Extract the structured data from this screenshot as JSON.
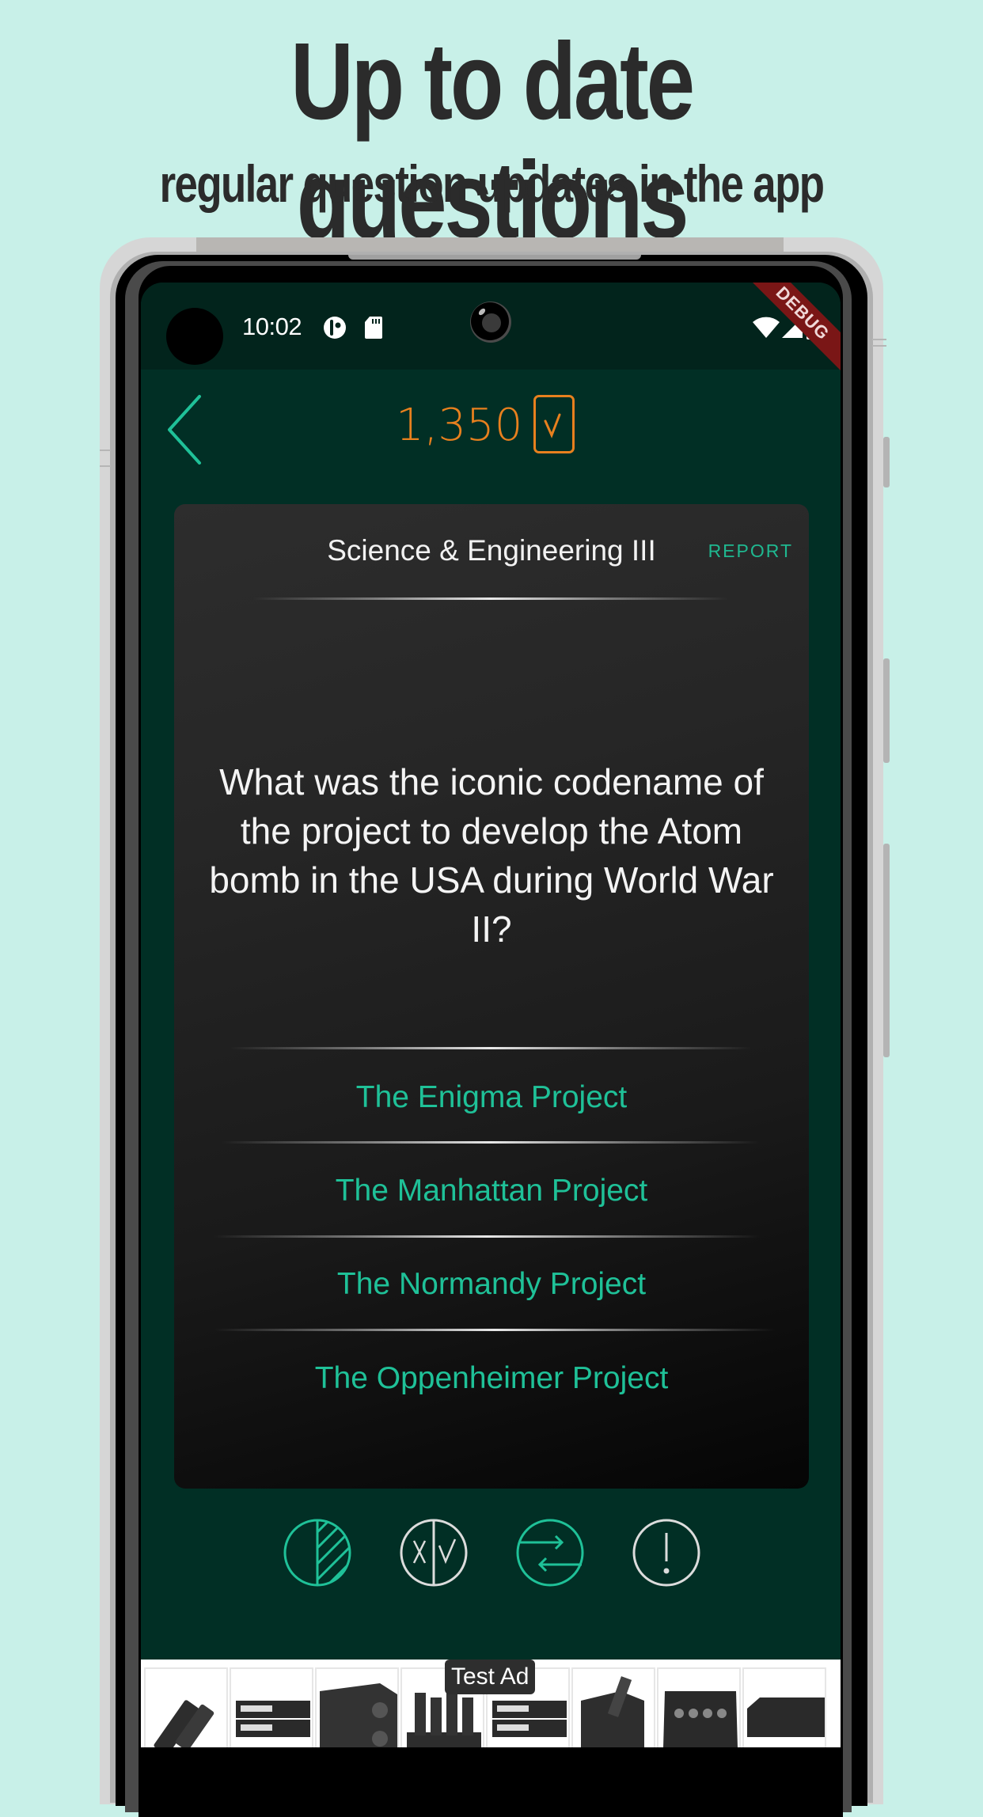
{
  "promo": {
    "headline": "Up to date questions",
    "subheadline": "regular question updates in the app"
  },
  "status_bar": {
    "time": "10:02",
    "left_icons": [
      "app-notification-icon",
      "sd-card-icon"
    ],
    "right_icons": [
      "wifi-icon",
      "cellular-signal-icon",
      "battery-icon"
    ],
    "debug_banner": "DEBUG"
  },
  "app_bar": {
    "back_icon": "chevron-left-icon",
    "score": "1,350",
    "score_icon": "checkmark-box-icon"
  },
  "card": {
    "category": "Science & Engineering III",
    "report_label": "REPORT",
    "question": "What was the iconic codename of the project to develop the Atom bomb in the USA during World War II?",
    "answers": [
      {
        "label": "The Enigma Project"
      },
      {
        "label": "The Manhattan Project"
      },
      {
        "label": "The Normandy Project"
      },
      {
        "label": "The Oppenheimer Project"
      }
    ]
  },
  "lifelines": [
    {
      "name": "fifty-fifty",
      "icon": "half-hatched-circle-icon",
      "active": true
    },
    {
      "name": "true-false-vote",
      "icon": "x-check-split-icon",
      "active": false
    },
    {
      "name": "swap-question",
      "icon": "swap-arrows-icon",
      "active": true
    },
    {
      "name": "hint",
      "icon": "exclamation-circle-icon",
      "active": false
    }
  ],
  "ad": {
    "label": "Test Ad",
    "tile_count": 8
  },
  "colors": {
    "background": "#c8f0e8",
    "screen": "#012f25",
    "accent_teal": "#1fc198",
    "score_orange": "#e8801e",
    "debug_red": "#7a1616"
  }
}
